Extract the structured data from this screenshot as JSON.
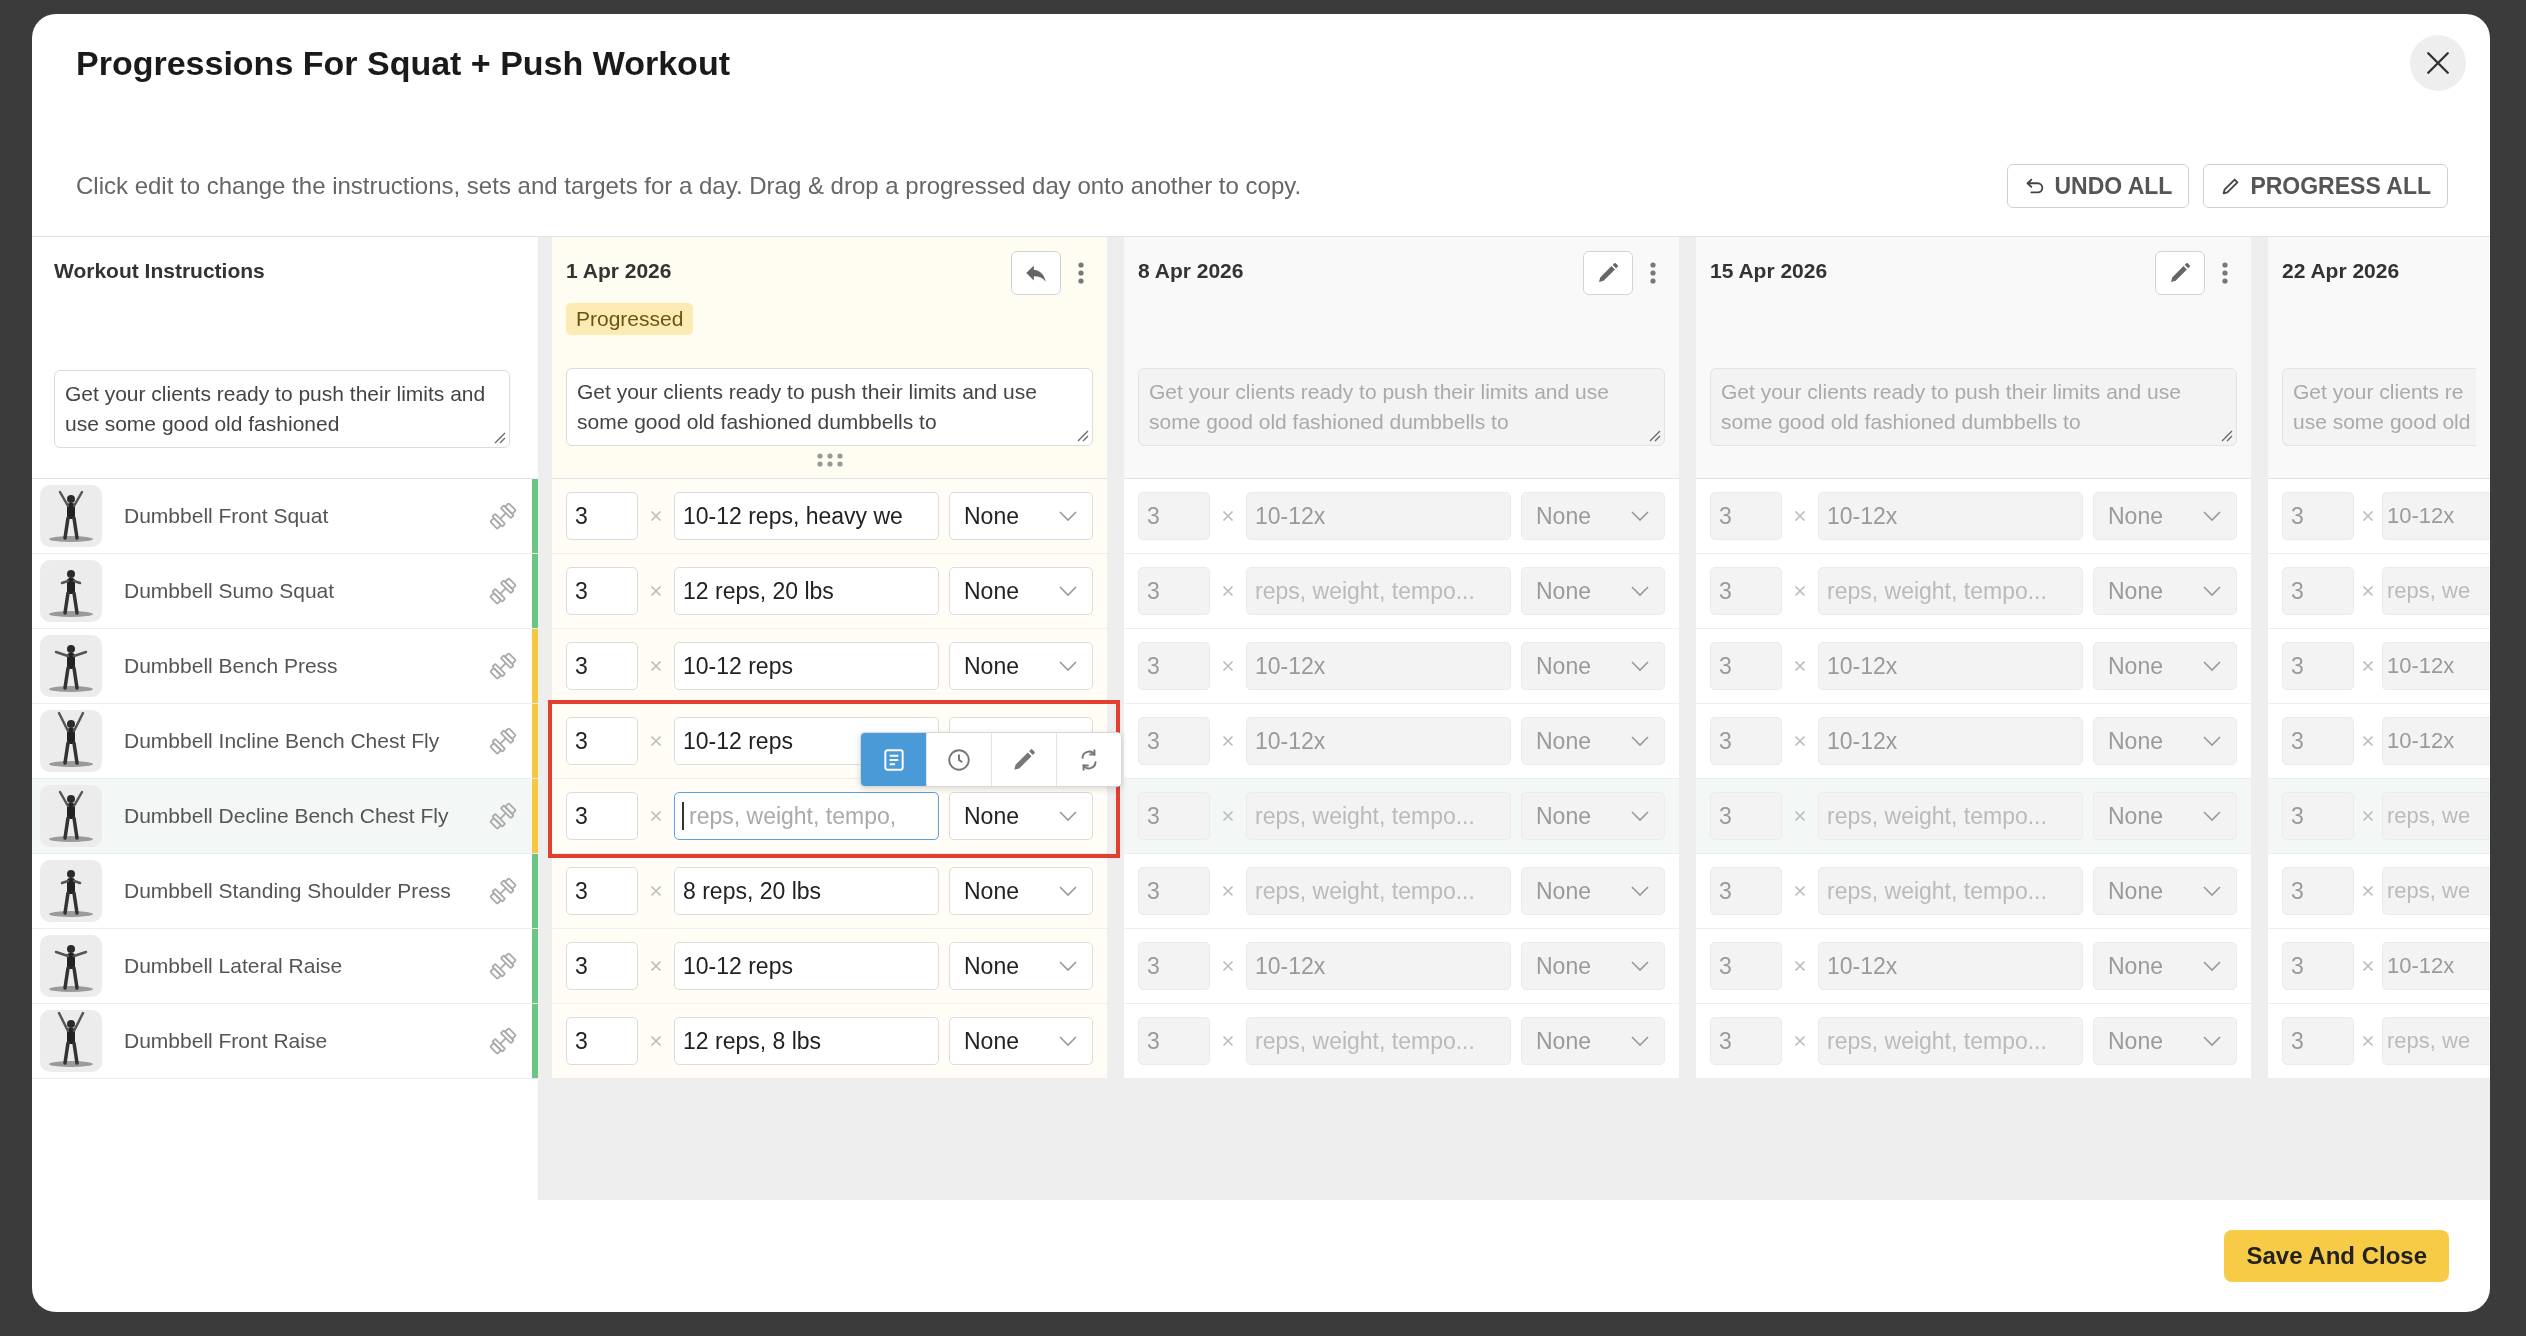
{
  "title": "Progressions For Squat + Push Workout",
  "description": "Click edit to change the instructions, sets and targets for a day. Drag & drop a progressed day onto another to copy.",
  "actions": [
    {
      "kind": "undo",
      "label": "UNDO ALL"
    },
    {
      "kind": "edit",
      "label": "PROGRESS ALL"
    }
  ],
  "instructions": {
    "heading": "Workout Instructions",
    "text": "Get your clients ready to push their limits and use some good old fashioned"
  },
  "exercises": [
    {
      "name": "Dumbbell Front Squat",
      "color": "#6cc486",
      "selected": false
    },
    {
      "name": "Dumbbell Sumo Squat",
      "color": "#6cc486",
      "selected": false
    },
    {
      "name": "Dumbbell Bench Press",
      "color": "#f5c842",
      "selected": false
    },
    {
      "name": "Dumbbell Incline Bench Chest Fly",
      "color": "#f5c842",
      "selected": false
    },
    {
      "name": "Dumbbell Decline Bench Chest Fly",
      "color": "#f5c842",
      "selected": true
    },
    {
      "name": "Dumbbell Standing Shoulder Press",
      "color": "#6cc486",
      "selected": false
    },
    {
      "name": "Dumbbell Lateral Raise",
      "color": "#6cc486",
      "selected": false
    },
    {
      "name": "Dumbbell Front Raise",
      "color": "#6cc486",
      "selected": false
    }
  ],
  "days": [
    {
      "date": "1 Apr 2026",
      "action": {
        "kind": "undo"
      },
      "menu": true,
      "progressed": true,
      "badge": "Progressed",
      "instructions": "Get your clients ready to push their limits and use some good old fashioned dumbbells to",
      "drag_handle": true,
      "rows": [
        {
          "sets": "3",
          "target": {
            "value": "10-12 reps, heavy we"
          },
          "rest": "None",
          "outlined": false
        },
        {
          "sets": "3",
          "target": {
            "value": "12 reps, 20 lbs"
          },
          "rest": "None",
          "outlined": false
        },
        {
          "sets": "3",
          "target": {
            "value": "10-12 reps"
          },
          "rest": "None",
          "outlined": false
        },
        {
          "sets": "3",
          "target": {
            "value": "10-12 reps"
          },
          "outlined": true,
          "toolbar": [
            {
              "kind": "notes",
              "selected": true
            },
            {
              "kind": "clock",
              "selected": false
            },
            {
              "kind": "pencil",
              "selected": false
            },
            {
              "kind": "swap",
              "selected": false
            }
          ]
        },
        {
          "sets": "3",
          "target": {
            "placeholder": "reps, weight, tempo,",
            "focused": true
          },
          "rest": "None",
          "outlined": true
        },
        {
          "sets": "3",
          "target": {
            "value": "8 reps, 20 lbs"
          },
          "rest": "None",
          "outlined": false
        },
        {
          "sets": "3",
          "target": {
            "value": "10-12 reps"
          },
          "rest": "None",
          "outlined": false
        },
        {
          "sets": "3",
          "target": {
            "value": "12 reps, 8 lbs"
          },
          "rest": "None",
          "outlined": false
        }
      ]
    },
    {
      "date": "8 Apr 2026",
      "action": {
        "kind": "edit"
      },
      "menu": true,
      "progressed": false,
      "instructions": "Get your clients ready to push their limits and use some good old fashioned dumbbells to",
      "drag_handle": false,
      "rows": [
        {
          "sets": "3",
          "target": {
            "value": "10-12x"
          },
          "rest": "None"
        },
        {
          "sets": "3",
          "target": {
            "placeholder": "reps, weight, tempo..."
          },
          "rest": "None"
        },
        {
          "sets": "3",
          "target": {
            "value": "10-12x"
          },
          "rest": "None"
        },
        {
          "sets": "3",
          "target": {
            "value": "10-12x"
          },
          "rest": "None"
        },
        {
          "sets": "3",
          "target": {
            "placeholder": "reps, weight, tempo..."
          },
          "rest": "None"
        },
        {
          "sets": "3",
          "target": {
            "placeholder": "reps, weight, tempo..."
          },
          "rest": "None"
        },
        {
          "sets": "3",
          "target": {
            "value": "10-12x"
          },
          "rest": "None"
        },
        {
          "sets": "3",
          "target": {
            "placeholder": "reps, weight, tempo..."
          },
          "rest": "None"
        }
      ]
    },
    {
      "date": "15 Apr 2026",
      "action": {
        "kind": "edit"
      },
      "menu": true,
      "progressed": false,
      "instructions": "Get your clients ready to push their limits and use some good old fashioned dumbbells to",
      "drag_handle": false,
      "rows": [
        {
          "sets": "3",
          "target": {
            "value": "10-12x"
          },
          "rest": "None"
        },
        {
          "sets": "3",
          "target": {
            "placeholder": "reps, weight, tempo..."
          },
          "rest": "None"
        },
        {
          "sets": "3",
          "target": {
            "value": "10-12x"
          },
          "rest": "None"
        },
        {
          "sets": "3",
          "target": {
            "value": "10-12x"
          },
          "rest": "None"
        },
        {
          "sets": "3",
          "target": {
            "placeholder": "reps, weight, tempo..."
          },
          "rest": "None"
        },
        {
          "sets": "3",
          "target": {
            "placeholder": "reps, weight, tempo..."
          },
          "rest": "None"
        },
        {
          "sets": "3",
          "target": {
            "value": "10-12x"
          },
          "rest": "None"
        },
        {
          "sets": "3",
          "target": {
            "placeholder": "reps, weight, tempo..."
          },
          "rest": "None"
        }
      ]
    },
    {
      "date": "22 Apr 2026",
      "progressed": false,
      "instructions": "Get your clients re\nuse some good old",
      "drag_handle": false,
      "rows": [
        {
          "sets": "3",
          "target": {
            "value": "10-12x"
          }
        },
        {
          "sets": "3",
          "target": {
            "placeholder": "reps, we"
          }
        },
        {
          "sets": "3",
          "target": {
            "value": "10-12x"
          }
        },
        {
          "sets": "3",
          "target": {
            "value": "10-12x"
          }
        },
        {
          "sets": "3",
          "target": {
            "placeholder": "reps, we"
          }
        },
        {
          "sets": "3",
          "target": {
            "placeholder": "reps, we"
          }
        },
        {
          "sets": "3",
          "target": {
            "value": "10-12x"
          }
        },
        {
          "sets": "3",
          "target": {
            "placeholder": "reps, we"
          }
        }
      ]
    }
  ],
  "save_button": "Save And Close"
}
